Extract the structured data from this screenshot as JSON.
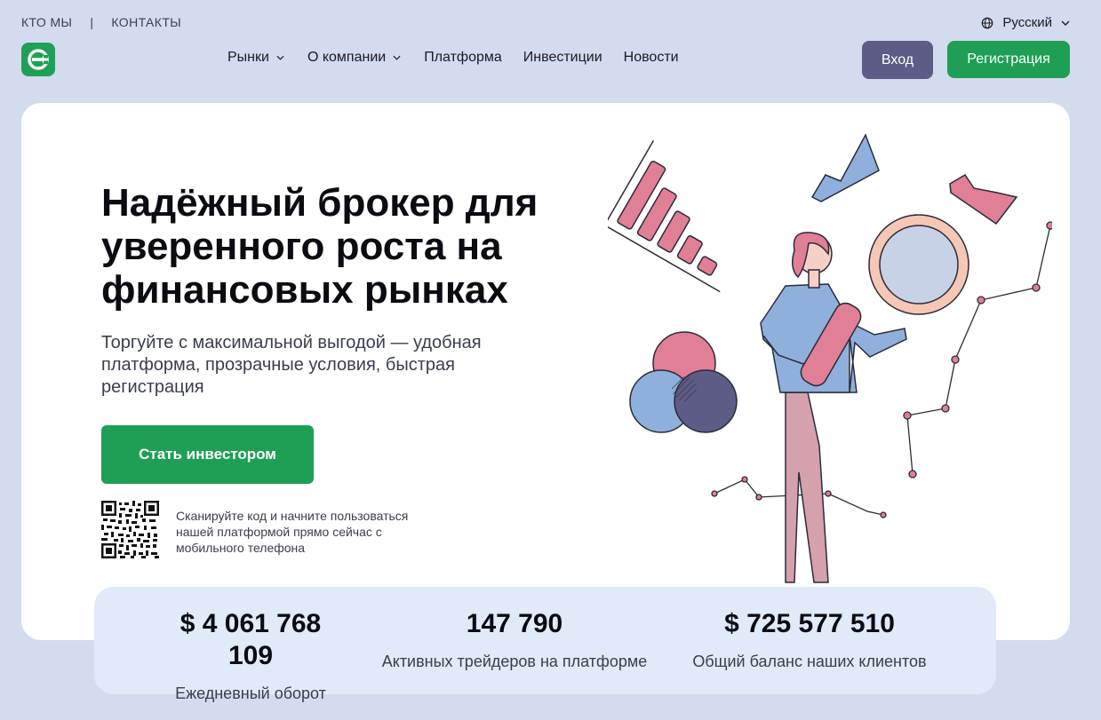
{
  "topbar": {
    "links": [
      "КТО МЫ",
      "КОНТАКТЫ"
    ],
    "separator": "|",
    "language": "Русский"
  },
  "nav": {
    "items": [
      {
        "label": "Рынки",
        "dropdown": true
      },
      {
        "label": "О компании",
        "dropdown": true
      },
      {
        "label": "Платформа",
        "dropdown": false
      },
      {
        "label": "Инвестиции",
        "dropdown": false
      },
      {
        "label": "Новости",
        "dropdown": false
      }
    ],
    "login": "Вход",
    "register": "Регистрация"
  },
  "hero": {
    "title_lines": [
      "Надёжный брокер для",
      "уверенного роста на",
      "финансовых рынках"
    ],
    "subtitle": "Торгуйте с максимальной выгодой — удобная платформа, прозрачные условия, быстрая регистрация",
    "cta": "Стать инвестором",
    "qr_text": "Сканируйте код и начните пользоваться нашей платформой прямо сейчас с мобильного телефона"
  },
  "stats": [
    {
      "value": "$ 4 061 768 109",
      "label": "Ежедневный оборот"
    },
    {
      "value": "147 790",
      "label": "Активных трейдеров на платформе"
    },
    {
      "value": "$ 725 577 510",
      "label": "Общий баланс наших клиентов"
    }
  ],
  "colors": {
    "background": "#d3dbef",
    "primary_green": "#1f9f55",
    "login_purple": "#5d5c86",
    "stats_bg": "#e1eaf8",
    "illus_pink": "#e07f95",
    "illus_blue": "#8fb0dc"
  },
  "icons": {
    "language": "globe-icon",
    "dropdown": "chevron-down-icon",
    "logo": "logo-icon"
  }
}
